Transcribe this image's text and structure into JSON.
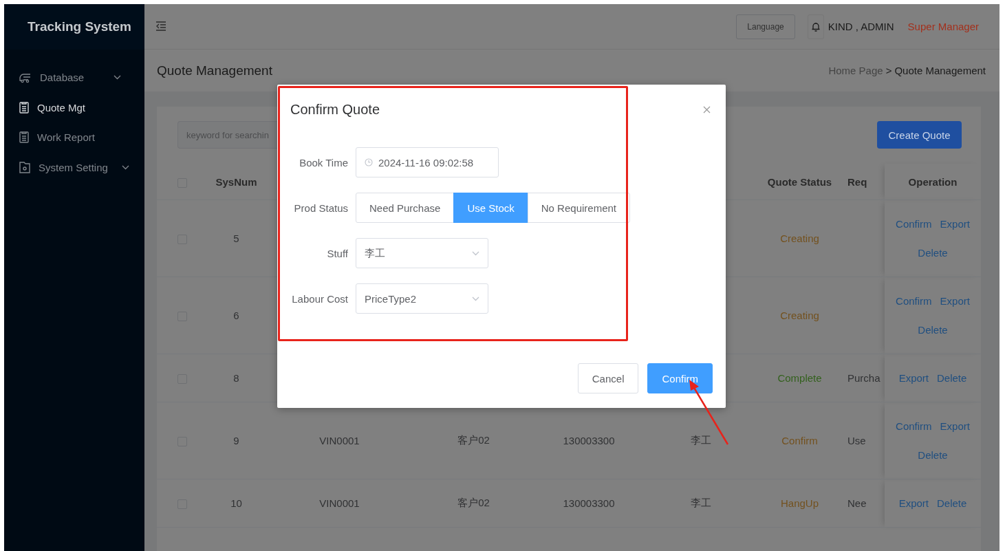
{
  "sidebar": {
    "title": "Tracking System",
    "items": [
      {
        "label": "Database",
        "kind": "truck",
        "expandable": true,
        "selected": false
      },
      {
        "label": "Quote Mgt",
        "kind": "document",
        "expandable": false,
        "selected": true
      },
      {
        "label": "Work Report",
        "kind": "document",
        "expandable": false,
        "selected": false
      },
      {
        "label": "System Setting",
        "kind": "folder",
        "expandable": true,
        "selected": false
      }
    ]
  },
  "header": {
    "language_button": "Language",
    "user": "KIND , ADMIN",
    "role": "Super Manager"
  },
  "page": {
    "title": "Quote Management",
    "breadcrumb": {
      "items": [
        "Home Page",
        "Quote Management"
      ],
      "separator": ">"
    }
  },
  "toolbar": {
    "search": {
      "placeholder": "keyword for searchin"
    },
    "create_button": "Create Quote"
  },
  "table": {
    "select_all_checked": false,
    "header": {
      "sysnum": "SysNum",
      "quote_status": "Quote Status",
      "column_8": "Req",
      "operation": "Operation"
    },
    "rows": [
      {
        "checked": false,
        "sysnum": "5",
        "quote_status": {
          "label": "Creating",
          "color": "#73511e"
        },
        "operations": [
          "Confirm",
          "Export",
          "Delete"
        ]
      },
      {
        "checked": false,
        "sysnum": "6",
        "quote_status": {
          "label": "Creating",
          "color": "#73511e"
        },
        "operations": [
          "Confirm",
          "Export",
          "Delete"
        ]
      },
      {
        "checked": false,
        "sysnum": "8",
        "quote_status": {
          "label": "Complete",
          "color": "#33611d"
        },
        "column_8": "Purcha",
        "operations": [
          "Export",
          "Delete"
        ]
      },
      {
        "checked": false,
        "sysnum": "9",
        "column_3": "VIN0001",
        "column_4": "客户02",
        "column_5": "130003300",
        "column_6": "李工",
        "quote_status": {
          "label": "Confirm",
          "color": "#73511e"
        },
        "column_8": "Use",
        "operations": [
          "Confirm",
          "Export",
          "Delete"
        ]
      },
      {
        "checked": false,
        "sysnum": "10",
        "column_3": "VIN0001",
        "column_4": "客户02",
        "column_5": "130003300",
        "column_6": "李工",
        "quote_status": {
          "label": "HangUp",
          "color": "#73511e"
        },
        "column_8": "Nee",
        "operations": [
          "Export",
          "Delete"
        ]
      }
    ]
  },
  "dialog": {
    "title": "Confirm Quote",
    "fields": [
      {
        "kind": "datetime",
        "label": "Book Time",
        "value": "2024-11-16 09:02:58"
      },
      {
        "kind": "radio",
        "label": "Prod Status",
        "options": [
          {
            "label": "Need Purchase",
            "selected": false
          },
          {
            "label": "Use Stock",
            "selected": true
          },
          {
            "label": "No Requirement",
            "selected": false
          }
        ]
      },
      {
        "kind": "select",
        "label": "Stuff",
        "value": "李工"
      },
      {
        "kind": "select",
        "label": "Labour Cost",
        "value": "PriceType2"
      }
    ],
    "buttons": [
      {
        "label": "Cancel",
        "kind": "default"
      },
      {
        "label": "Confirm",
        "kind": "primary"
      }
    ]
  }
}
